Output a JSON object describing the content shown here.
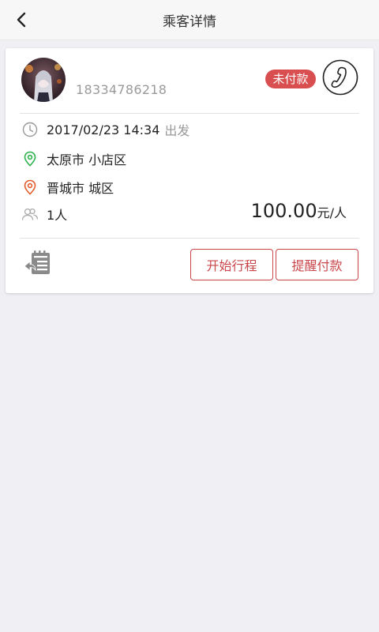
{
  "header": {
    "title": "乘客详情",
    "back_icon": "chevron-left-icon"
  },
  "passenger": {
    "phone": "18334786218",
    "status": "未付款",
    "status_color": "#d94f4f",
    "time": "2017/02/23 14:34",
    "time_suffix": "出发",
    "origin": "太原市 小店区",
    "destination": "晋城市 城区",
    "seats": "1人",
    "price": "100.00",
    "price_unit": "元/人"
  },
  "actions": {
    "start_trip": "开始行程",
    "remind_payment": "提醒付款"
  },
  "colors": {
    "accent": "#c9464a",
    "origin_pin": "#2bb24c",
    "destination_pin": "#e25a2b"
  }
}
